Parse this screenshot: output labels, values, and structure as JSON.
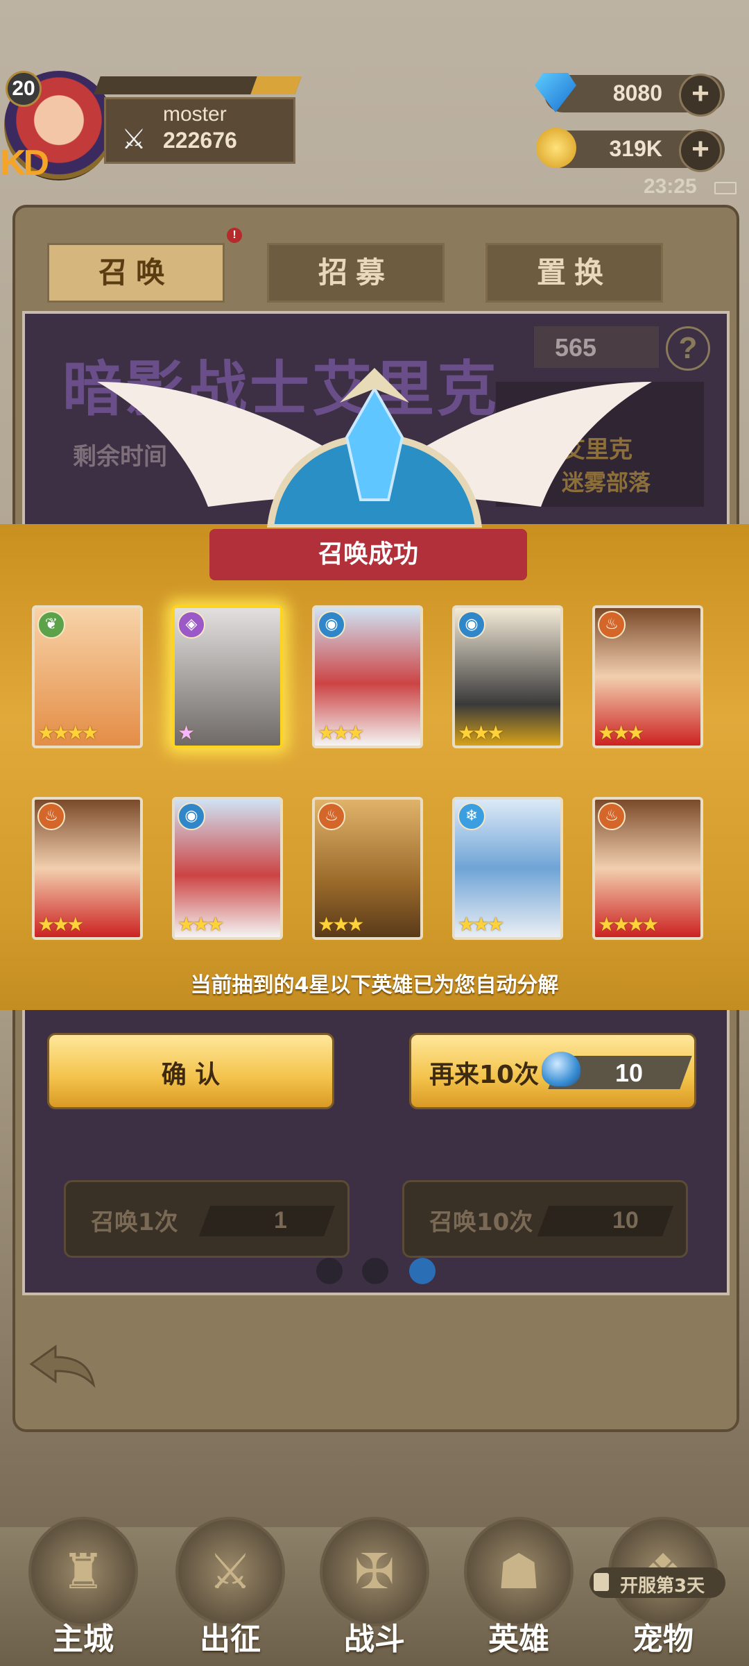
{
  "player": {
    "level": "20",
    "name": "moster",
    "power": "222676",
    "server_tag": "KD"
  },
  "resources": {
    "gems": "8080",
    "gold": "319K"
  },
  "status": {
    "time": "23:25"
  },
  "tabs": [
    {
      "label": "召唤",
      "active": true
    },
    {
      "label": "招募",
      "active": false
    },
    {
      "label": "置换",
      "active": false
    }
  ],
  "tab_badge": "!",
  "banner": {
    "title": "暗影战士艾里克",
    "subtitle": "剩余时间",
    "right_line1": "艾里克",
    "right_line2": "迷雾部落",
    "crystal_count": "565",
    "help": "?"
  },
  "result": {
    "title": "召唤成功",
    "hint": "当前抽到的4星以下英雄已为您自动分解",
    "cards_row1": [
      {
        "element": "nature",
        "stars": "★★★★",
        "color": "#5ba24a"
      },
      {
        "element": "dark",
        "stars": "★",
        "color": "#9b58c7",
        "highlight": true
      },
      {
        "element": "water",
        "stars": "★★★",
        "color": "#2f86c8"
      },
      {
        "element": "water",
        "stars": "★★★",
        "color": "#2f86c8"
      },
      {
        "element": "fire",
        "stars": "★★★",
        "color": "#d4662a"
      }
    ],
    "cards_row2": [
      {
        "element": "fire",
        "stars": "★★★",
        "color": "#d4662a"
      },
      {
        "element": "water",
        "stars": "★★★",
        "color": "#2f86c8"
      },
      {
        "element": "fire",
        "stars": "★★★",
        "color": "#d4662a"
      },
      {
        "element": "ice",
        "stars": "★★★",
        "color": "#3a9ee0"
      },
      {
        "element": "fire",
        "stars": "★★★★",
        "color": "#d4662a"
      }
    ],
    "confirm_label": "确 认",
    "again_label": "再来10次",
    "again_cost": "10"
  },
  "summon_buttons": [
    {
      "label": "召唤1次",
      "cost": "1"
    },
    {
      "label": "召唤10次",
      "cost": "10"
    }
  ],
  "nav": [
    {
      "label": "主城",
      "icon": "castle-icon"
    },
    {
      "label": "出征",
      "icon": "crossed-swords-icon"
    },
    {
      "label": "战斗",
      "icon": "battle-icon"
    },
    {
      "label": "英雄",
      "icon": "hood-icon"
    },
    {
      "label": "宠物",
      "icon": "pet-icon"
    }
  ],
  "locked_tag": "开服第3天"
}
